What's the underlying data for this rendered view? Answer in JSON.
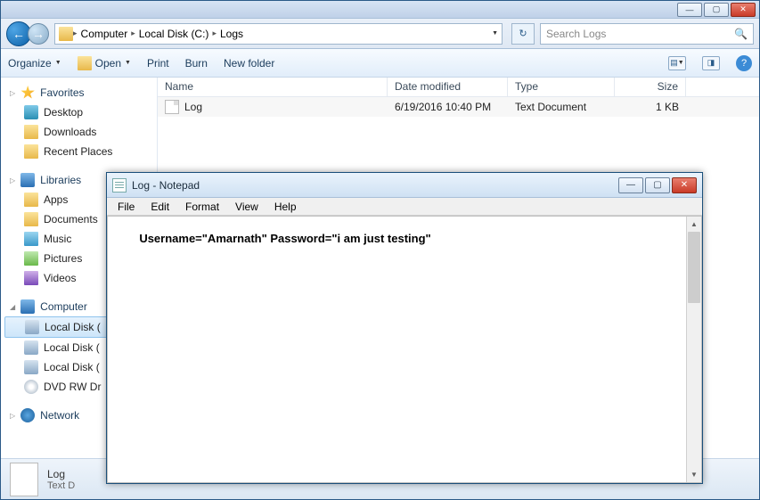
{
  "explorer": {
    "breadcrumb": {
      "root": "Computer",
      "seg1": "Local Disk (C:)",
      "seg2": "Logs"
    },
    "search_placeholder": "Search Logs",
    "toolbar": {
      "organize": "Organize",
      "open": "Open",
      "print": "Print",
      "burn": "Burn",
      "new_folder": "New folder"
    },
    "columns": {
      "name": "Name",
      "date": "Date modified",
      "type": "Type",
      "size": "Size"
    },
    "file": {
      "name": "Log",
      "date": "6/19/2016 10:40 PM",
      "type": "Text Document",
      "size": "1 KB"
    },
    "sidebar": {
      "favorites": "Favorites",
      "desktop": "Desktop",
      "downloads": "Downloads",
      "recent": "Recent Places",
      "libraries": "Libraries",
      "apps": "Apps",
      "documents": "Documents",
      "music": "Music",
      "pictures": "Pictures",
      "videos": "Videos",
      "computer": "Computer",
      "drive1": "Local Disk (",
      "drive2": "Local Disk (",
      "drive3": "Local Disk (",
      "dvd": "DVD RW Dr",
      "network": "Network"
    },
    "details": {
      "name": "Log",
      "type": "Text D"
    }
  },
  "notepad": {
    "title": "Log - Notepad",
    "menu": {
      "file": "File",
      "edit": "Edit",
      "format": "Format",
      "view": "View",
      "help": "Help"
    },
    "content": "Username=\"Amarnath\" Password=\"i am just testing\""
  }
}
